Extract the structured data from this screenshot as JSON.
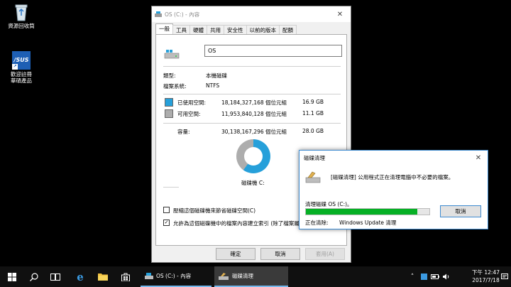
{
  "desktop": {
    "icons": [
      {
        "label": "資源回收筒",
        "icon": "recycle-bin-icon"
      },
      {
        "label": "歡迎註冊華碩產品",
        "icon": "asus-icon"
      }
    ]
  },
  "properties": {
    "title": "OS (C:) - 內容",
    "tabs": [
      "一般",
      "工具",
      "硬體",
      "共用",
      "安全性",
      "以前的版本",
      "配額"
    ],
    "drive_name": "OS",
    "type_label": "類型:",
    "type_value": "本機磁碟",
    "fs_label": "檔案系統:",
    "fs_value": "NTFS",
    "used_label": "已使用空間:",
    "used_bytes": "18,184,327,168 個位元組",
    "used_gb": "16.9 GB",
    "free_label": "可用空間:",
    "free_bytes": "11,953,840,128 個位元組",
    "free_gb": "11.1 GB",
    "capacity_label": "容量:",
    "capacity_bytes": "30,138,167,296 個位元組",
    "capacity_gb": "28.0 GB",
    "drive_caption": "磁碟機 C:",
    "compress_label": "壓縮這個磁碟機來節省磁碟空間(C)",
    "index_label": "允許為這個磁碟機中的檔案內容建立索引 (除了檔案屬",
    "ok": "確定",
    "cancel": "取消",
    "apply": "套用(A)",
    "used_color": "#26a0da",
    "free_color": "#adadad",
    "used_fraction": 0.6
  },
  "cleanup": {
    "title": "磁碟清理",
    "message": "[磁碟清理] 公用程式正在清理電腦中不必要的檔案。",
    "drive_line": "清理磁碟 OS (C:)。",
    "cancel": "取消",
    "cleaning_label": "正在清除:",
    "cleaning_item": "Windows Update 清理",
    "progress": 0.9,
    "progress_color": "#06b025"
  },
  "taskbar": {
    "apps": [
      {
        "label": "OS (C:) - 內容"
      },
      {
        "label": "磁碟清理"
      }
    ],
    "time": "下午 12:47",
    "date": "2017/7/18"
  }
}
